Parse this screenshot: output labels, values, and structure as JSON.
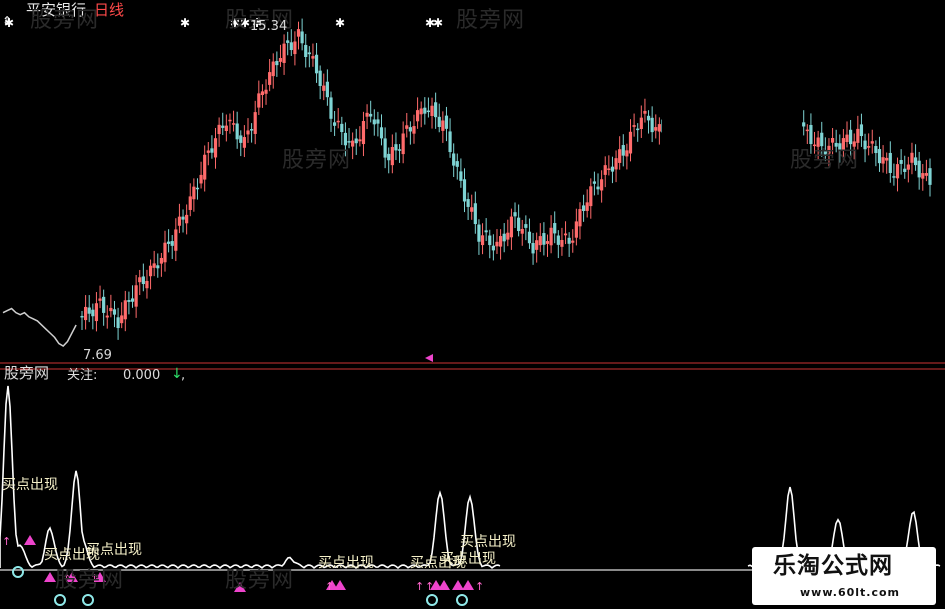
{
  "header": {
    "stock_name": "平安银行",
    "period": "日线"
  },
  "watermark": "股旁网",
  "price_chart": {
    "high_label": "15.34",
    "low_label": "7.69"
  },
  "indicator": {
    "name": "股旁网",
    "focus_label": "关注:",
    "focus_value": "0.000",
    "trend_arrow": "↓",
    "separator": ","
  },
  "signals": {
    "label": "买点出现"
  },
  "brand": {
    "title": "乐淘公式网",
    "url": "www.60lt.com"
  },
  "colors": {
    "up_candle": "#ff6b6b",
    "down_candle": "#7fd4d4",
    "signal_line": "#ffffff",
    "triangle": "#ee44cc",
    "separator": "#cc3333"
  },
  "chart_data": [
    {
      "type": "candlestick",
      "title": "平安银行 日线",
      "annotations": [
        "15.34",
        "7.69"
      ],
      "close": [
        8.4,
        8.7,
        8.3,
        9.1,
        9.6,
        10.3,
        11.2,
        12.4,
        13.2,
        12.6,
        13.9,
        14.8,
        15.2,
        14.4,
        13.1,
        12.5,
        13.4,
        12.2,
        12.9,
        13.5,
        13.1,
        11.6,
        10.4,
        10.1,
        10.8,
        10.1,
        10.4,
        10.2,
        11.3,
        11.9,
        12.4,
        13.3,
        12.9,
        13.1,
        13.6,
        null,
        null,
        null,
        null,
        null,
        12.9,
        12.5,
        12.6,
        12.8,
        12.4,
        11.9,
        12.2,
        11.6
      ]
    },
    {
      "type": "line",
      "title": "股旁网 关注",
      "annotations": [
        "买点出现"
      ],
      "value_printed": "0.000"
    }
  ]
}
